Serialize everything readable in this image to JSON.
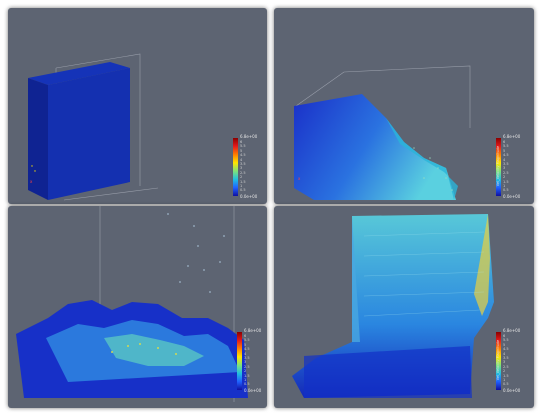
{
  "panels": [
    {
      "legend": {
        "max": "6.8e+00",
        "min": "0.0e+00",
        "title": "",
        "ticks": [
          "6",
          "5.5",
          "5",
          "4.5",
          "4",
          "3.5",
          "3",
          "2.5",
          "2",
          "1.5",
          "1",
          "0.5"
        ]
      }
    },
    {
      "legend": {
        "max": "6.8e+00",
        "min": "0.0e+00",
        "title": "Vel_Velocity Magnitude",
        "ticks": [
          "6",
          "5.5",
          "5",
          "4.5",
          "4",
          "3.5",
          "3",
          "2.5",
          "2",
          "1.5",
          "1",
          "0.5"
        ]
      }
    },
    {
      "legend": {
        "max": "6.8e+00",
        "min": "0.0e+00",
        "title": "",
        "ticks": [
          "6",
          "5.5",
          "5",
          "4.5",
          "4",
          "3.5",
          "3",
          "2.5",
          "2",
          "1.5",
          "1",
          "0.5"
        ]
      }
    },
    {
      "legend": {
        "max": "6.8e+00",
        "min": "0.0e+00",
        "title": "Vel_Velocity Magnitude",
        "ticks": [
          "6",
          "5.5",
          "5",
          "4.5",
          "4",
          "3.5",
          "3",
          "2.5",
          "2",
          "1.5",
          "1",
          "0.5"
        ]
      }
    }
  ],
  "colors": {
    "background": "#5d6472",
    "fluid_low": "#1a2fd0",
    "fluid_mid": "#2fa8e0",
    "fluid_high": "#e8e040",
    "fluid_peak": "#e03020"
  }
}
